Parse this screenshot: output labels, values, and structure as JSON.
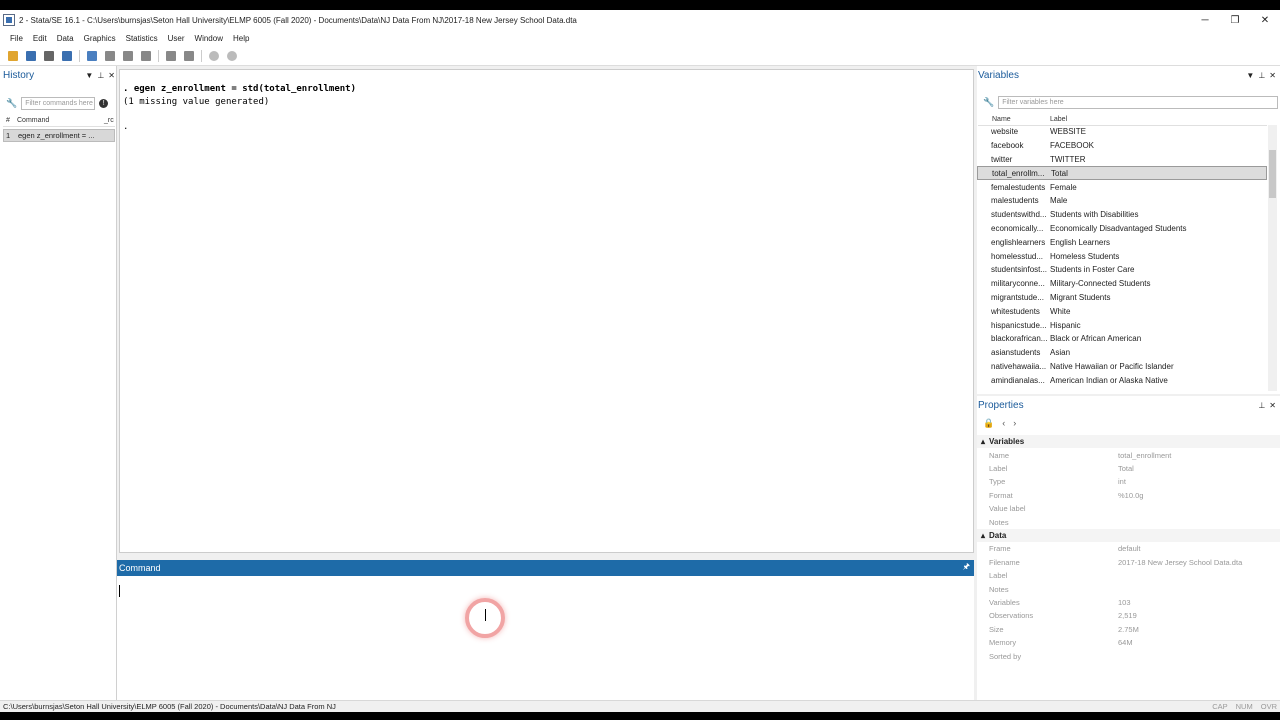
{
  "window": {
    "title": "2 - Stata/SE 16.1 - C:\\Users\\burnsjas\\Seton Hall University\\ELMP 6005 (Fall 2020) - Documents\\Data\\NJ Data From NJ\\2017-18 New Jersey School Data.dta",
    "minimize": "─",
    "restore": "❐",
    "close": "✕"
  },
  "menu": [
    "File",
    "Edit",
    "Data",
    "Graphics",
    "Statistics",
    "User",
    "Window",
    "Help"
  ],
  "toolbar_icons": [
    {
      "name": "open-icon",
      "color": "#e0a530"
    },
    {
      "name": "save-icon",
      "color": "#3a6fb0"
    },
    {
      "name": "print-icon",
      "color": "#666666"
    },
    {
      "name": "log-icon",
      "color": "#3a6fb0"
    },
    {
      "name": "viewer-icon",
      "color": "#4a7fc0"
    },
    {
      "name": "graph-icon",
      "color": "#888888"
    },
    {
      "name": "do-editor-icon",
      "color": "#888888"
    },
    {
      "name": "data-editor-icon",
      "color": "#888888"
    },
    {
      "name": "data-browser-icon",
      "color": "#888888"
    },
    {
      "name": "variables-manager-icon",
      "color": "#888888"
    },
    {
      "name": "more-icon",
      "color": "#bbbbbb"
    },
    {
      "name": "break-icon",
      "color": "#bbbbbb"
    }
  ],
  "history": {
    "title": "History",
    "filter_placeholder": "Filter commands here",
    "col_num": "#",
    "col_command": "Command",
    "col_rc": "_rc",
    "items": [
      {
        "num": "1",
        "command": "egen z_enrollment = ..."
      }
    ]
  },
  "results": {
    "lines": [
      ". egen z_enrollment = std(total_enrollment)",
      "(1 missing value generated)",
      "",
      "."
    ]
  },
  "command": {
    "title": "Command",
    "pin": "🖈"
  },
  "variables": {
    "title": "Variables",
    "filter_placeholder": "Filter variables here",
    "col_name": "Name",
    "col_label": "Label",
    "rows": [
      {
        "name": "website",
        "label": "WEBSITE"
      },
      {
        "name": "facebook",
        "label": "FACEBOOK"
      },
      {
        "name": "twitter",
        "label": "TWITTER"
      },
      {
        "name": "total_enrollm...",
        "label": "Total",
        "selected": true
      },
      {
        "name": "femalestudents",
        "label": "Female"
      },
      {
        "name": "malestudents",
        "label": "Male"
      },
      {
        "name": "studentswithd...",
        "label": "Students with Disabilities"
      },
      {
        "name": "economically...",
        "label": "Economically Disadvantaged Students"
      },
      {
        "name": "englishlearners",
        "label": "English Learners"
      },
      {
        "name": "homelesstud...",
        "label": "Homeless Students"
      },
      {
        "name": "studentsinfost...",
        "label": "Students in Foster Care"
      },
      {
        "name": "militaryconne...",
        "label": "Military-Connected Students"
      },
      {
        "name": "migrantstude...",
        "label": "Migrant Students"
      },
      {
        "name": "whitestudents",
        "label": "White"
      },
      {
        "name": "hispanicstude...",
        "label": "Hispanic"
      },
      {
        "name": "blackorafrican...",
        "label": "Black or African American"
      },
      {
        "name": "asianstudents",
        "label": "Asian"
      },
      {
        "name": "nativehawaiia...",
        "label": "Native Hawaiian or Pacific Islander"
      },
      {
        "name": "amindianalas...",
        "label": "American Indian or Alaska Native"
      }
    ]
  },
  "properties": {
    "title": "Properties",
    "sections": [
      {
        "title": "Variables",
        "rows": [
          {
            "key": "Name",
            "value": "total_enrollment"
          },
          {
            "key": "Label",
            "value": "Total"
          },
          {
            "key": "Type",
            "value": "int"
          },
          {
            "key": "Format",
            "value": "%10.0g"
          },
          {
            "key": "Value label",
            "value": ""
          },
          {
            "key": "Notes",
            "value": ""
          }
        ]
      },
      {
        "title": "Data",
        "rows": [
          {
            "key": "Frame",
            "value": "default"
          },
          {
            "key": "Filename",
            "value": "2017-18 New Jersey School Data.dta"
          },
          {
            "key": "Label",
            "value": ""
          },
          {
            "key": "Notes",
            "value": ""
          },
          {
            "key": "Variables",
            "value": "103"
          },
          {
            "key": "Observations",
            "value": "2,519"
          },
          {
            "key": "Size",
            "value": "2.75M"
          },
          {
            "key": "Memory",
            "value": "64M"
          },
          {
            "key": "Sorted by",
            "value": ""
          }
        ]
      }
    ]
  },
  "status": {
    "path": "C:\\Users\\burnsjas\\Seton Hall University\\ELMP 6005 (Fall 2020) - Documents\\Data\\NJ Data From NJ",
    "flags": [
      "CAP",
      "NUM",
      "OVR"
    ]
  }
}
